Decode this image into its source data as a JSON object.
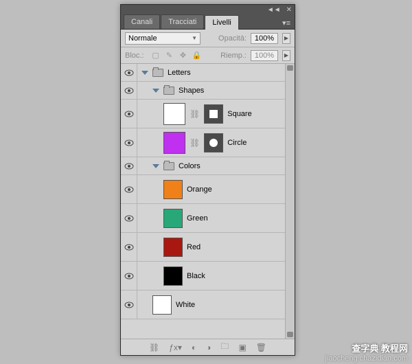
{
  "titlebar": {
    "collapse": "◄◄",
    "close": "✕"
  },
  "tabs": {
    "t0": "Canali",
    "t1": "Tracciati",
    "t2": "Livelli"
  },
  "opts": {
    "blend": "Normale",
    "opacity_lbl": "Opacità:",
    "opacity_val": "100%",
    "lock_lbl": "Bloc.:",
    "fill_lbl": "Riemp.:",
    "fill_val": "100%"
  },
  "layers": {
    "letters": "Letters",
    "shapes": "Shapes",
    "square": "Square",
    "circle": "Circle",
    "colors": "Colors",
    "orange": "Orange",
    "green": "Green",
    "red": "Red",
    "black": "Black",
    "white": "White"
  },
  "swatches": {
    "orange": "#f08018",
    "green": "#28a878",
    "red": "#a81810",
    "black": "#000000",
    "white": "#ffffff",
    "purple": "#c030f0"
  },
  "watermark": {
    "site": "jiaocheng.chazidian.com",
    "brand": "查字典 教程网"
  }
}
